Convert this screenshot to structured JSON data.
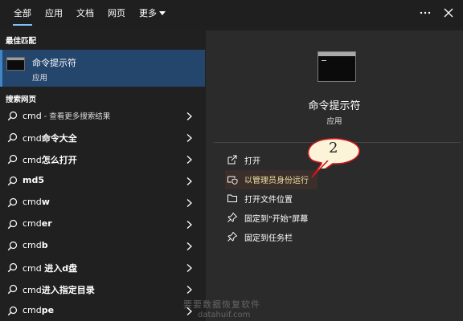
{
  "tabs": [
    "全部",
    "应用",
    "文档",
    "网页",
    "更多"
  ],
  "left": {
    "best_match_title": "最佳匹配",
    "best_match": {
      "name": "命令提示符",
      "type": "应用"
    },
    "web_title": "搜索网页",
    "results": [
      {
        "pre": "cmd",
        "bold": "",
        "dim": " - 查看更多搜索结果"
      },
      {
        "pre": "cmd",
        "bold": "命令大全",
        "dim": ""
      },
      {
        "pre": "cmd",
        "bold": "怎么打开",
        "dim": ""
      },
      {
        "pre": "",
        "bold": "md5",
        "dim": ""
      },
      {
        "pre": "cmd",
        "bold": "w",
        "dim": ""
      },
      {
        "pre": "cmd",
        "bold": "er",
        "dim": ""
      },
      {
        "pre": "cmd",
        "bold": "b",
        "dim": ""
      },
      {
        "pre": "cmd ",
        "bold": "进入d盘",
        "dim": ""
      },
      {
        "pre": "cmd",
        "bold": "进入指定目录",
        "dim": ""
      },
      {
        "pre": "cmd",
        "bold": "pe",
        "dim": ""
      }
    ]
  },
  "right": {
    "app_name": "命令提示符",
    "app_type": "应用",
    "actions": [
      "打开",
      "以管理员身份运行",
      "打开文件位置",
      "固定到\"开始\"屏幕",
      "固定到任务栏"
    ]
  },
  "callout_number": "2",
  "watermark": {
    "line1": "要要数据恢复软件",
    "line2": "datahuif.com"
  },
  "colors": {
    "accent": "#7cc0ff",
    "selected_bg": "#24456c",
    "callout_red": "#c8161e",
    "callout_fill": "#fbf4d8"
  }
}
